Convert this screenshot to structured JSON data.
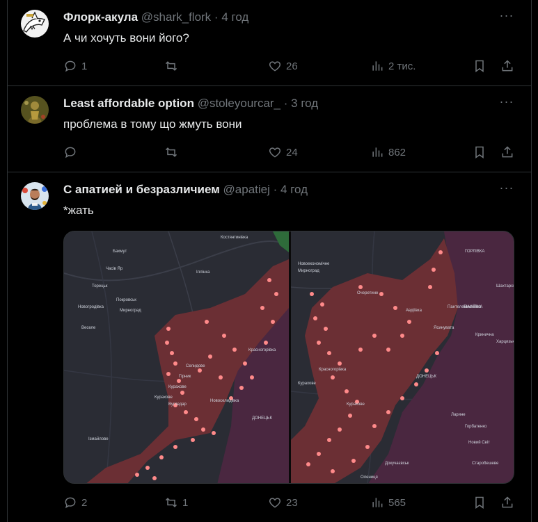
{
  "tweets": [
    {
      "name": "Флорк-акула",
      "handle": "@shark_flork",
      "separator": "·",
      "time": "4 год",
      "text": "А чи хочуть вони його?",
      "replies": "1",
      "retweets": "",
      "likes": "26",
      "views": "2 тис."
    },
    {
      "name": "Least affordable option",
      "handle": "@stoleyourcar_",
      "separator": "·",
      "time": "3 год",
      "text": "проблема в тому що жмуть вони",
      "replies": "",
      "retweets": "",
      "likes": "24",
      "views": "862"
    },
    {
      "name": "С апатией и безразличием",
      "handle": "@apatiej",
      "separator": "·",
      "time": "4 год",
      "text": "*жать",
      "replies": "2",
      "retweets": "1",
      "likes": "23",
      "views": "565"
    }
  ],
  "map_left_labels": [
    "Бахмут",
    "Часів Яр",
    "Торецьк",
    "Покровськ",
    "Мирноград",
    "Курахове",
    "Вугледар",
    "ДОНЕЦЬК",
    "Селидове",
    "Красногорівка",
    "Гірник",
    "Новоселидівка",
    "Новогродівка",
    "Кураховe",
    "Костянтинівка",
    "Іллінка",
    "Веселе",
    "Ізмайлове"
  ],
  "map_right_labels": [
    "ГОРЛІВКА",
    "МАКІЇВКА",
    "ДОНЕЦЬК",
    "Новоекономічне",
    "Мирноград",
    "Очеретине",
    "Авдіївка",
    "Ясинувата",
    "Курахове",
    "Красногорівка",
    "Кураховe",
    "Пантелеймонівка",
    "Кринична",
    "Харцизьк",
    "Ларине",
    "Горбатенко",
    "Новий Світ",
    "Старобешеве",
    "Докучаєвськ",
    "Олениця",
    "Шахтарськ"
  ],
  "colors": {
    "background": "#000000",
    "border": "#2f3336",
    "text": "#e7e9ea",
    "muted": "#71767b",
    "map_bg": "#2a2c34",
    "occupied": "#6b2f34",
    "ldnr": "#4a2740",
    "marker": "#ff8a8a"
  },
  "icons": [
    "comment-icon",
    "retweet-icon",
    "like-icon",
    "views-icon",
    "bookmark-icon",
    "share-icon",
    "more-icon"
  ]
}
